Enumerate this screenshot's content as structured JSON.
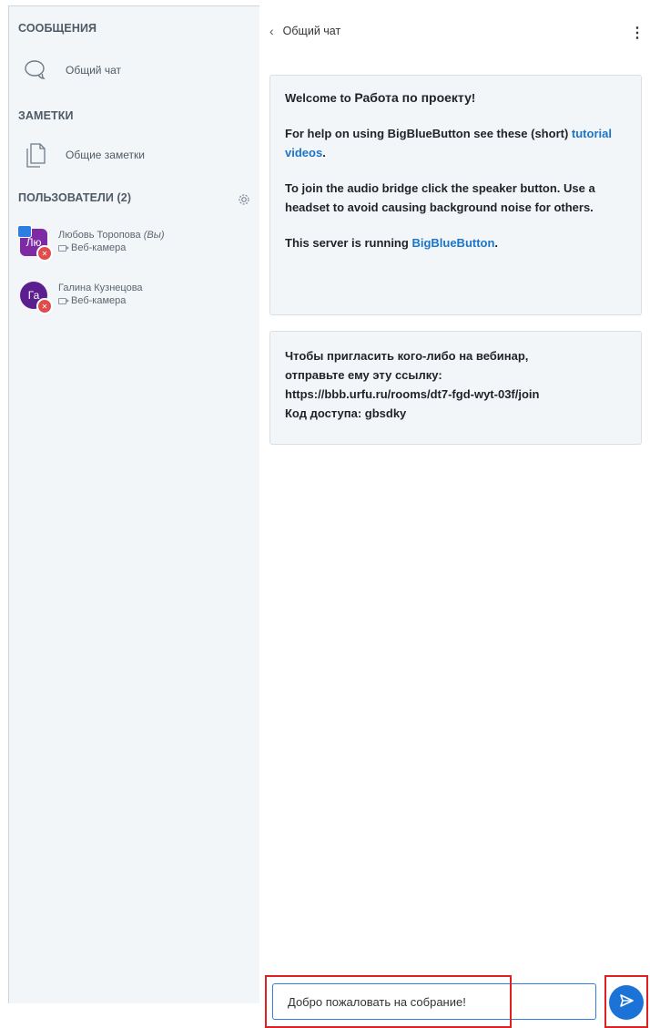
{
  "sidebar": {
    "messages_title": "СООБЩЕНИЯ",
    "public_chat_label": "Общий чат",
    "notes_title": "ЗАМЕТКИ",
    "shared_notes_label": "Общие заметки",
    "users_title": "ПОЛЬЗОВАТЕЛИ (2)",
    "users": [
      {
        "initials": "Лю",
        "name": "Любовь Торопова",
        "you_tag": "(Вы)",
        "status": "Веб-камера",
        "presenter": true
      },
      {
        "initials": "Га",
        "name": "Галина Кузнецова",
        "status": "Веб-камера",
        "presenter": false
      }
    ]
  },
  "chat": {
    "title": "Общий чат",
    "welcome": {
      "line1_prefix": "Welcome to ",
      "line1_meeting": "Работа по проекту",
      "line1_suffix": "!",
      "help_prefix": "For help on using BigBlueButton see these (short) ",
      "help_link": "tutorial videos",
      "help_suffix": ".",
      "audio_text": "To join the audio bridge click the speaker button. Use a headset to avoid causing background noise for others.",
      "server_prefix": "This server is running ",
      "server_link": "BigBlueButton",
      "server_suffix": "."
    },
    "invite": {
      "line1": "Чтобы пригласить кого-либо на вебинар,",
      "line2": "отправьте ему эту ссылку:",
      "line3": "https://bbb.urfu.ru/rooms/dt7-fgd-wyt-03f/join",
      "line4": "Код доступа: gbsdky"
    },
    "input_value": "Добро пожаловать на собрание!"
  },
  "colors": {
    "accent": "#1b73d8",
    "highlight": "#e02020",
    "avatar_purple": "#7d2aa4",
    "mic_red": "#e14b4b"
  },
  "icons": [
    "chat-bubble-icon",
    "notes-icon",
    "gear-icon",
    "back-chevron-icon",
    "kebab-menu-icon",
    "send-icon",
    "webcam-icon",
    "muted-mic-icon",
    "presenter-icon"
  ]
}
